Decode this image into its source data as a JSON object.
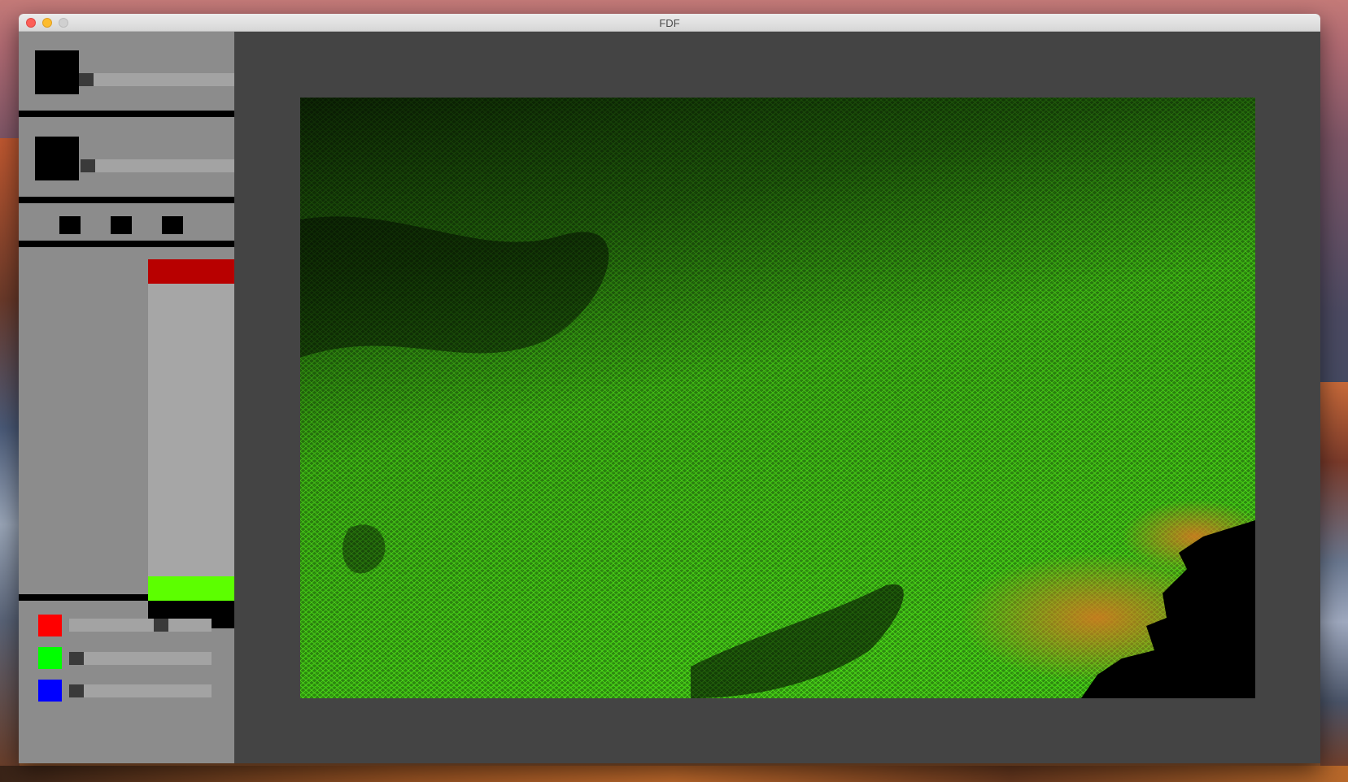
{
  "window": {
    "title": "FDF"
  },
  "sidebar": {
    "slider1": {
      "level": 0.0
    },
    "slider2": {
      "level": 0.0
    },
    "buttons": [
      "projection-button-1",
      "projection-button-2",
      "projection-button-3"
    ],
    "gradient": {
      "top_color": "#b80000",
      "bottom_color": "#5cff00"
    },
    "rgb_sliders": [
      {
        "name": "red",
        "color": "#ff0000",
        "level": 0.66
      },
      {
        "name": "green",
        "color": "#00ff00",
        "level": 0.0
      },
      {
        "name": "blue",
        "color": "#0000ff",
        "level": 0.0
      }
    ]
  },
  "viewport": {
    "background": "#444444",
    "wireframe": {
      "line_color": "#66ff22",
      "low_color": "#0a2a05",
      "peak_color": "#c86a1a"
    }
  }
}
